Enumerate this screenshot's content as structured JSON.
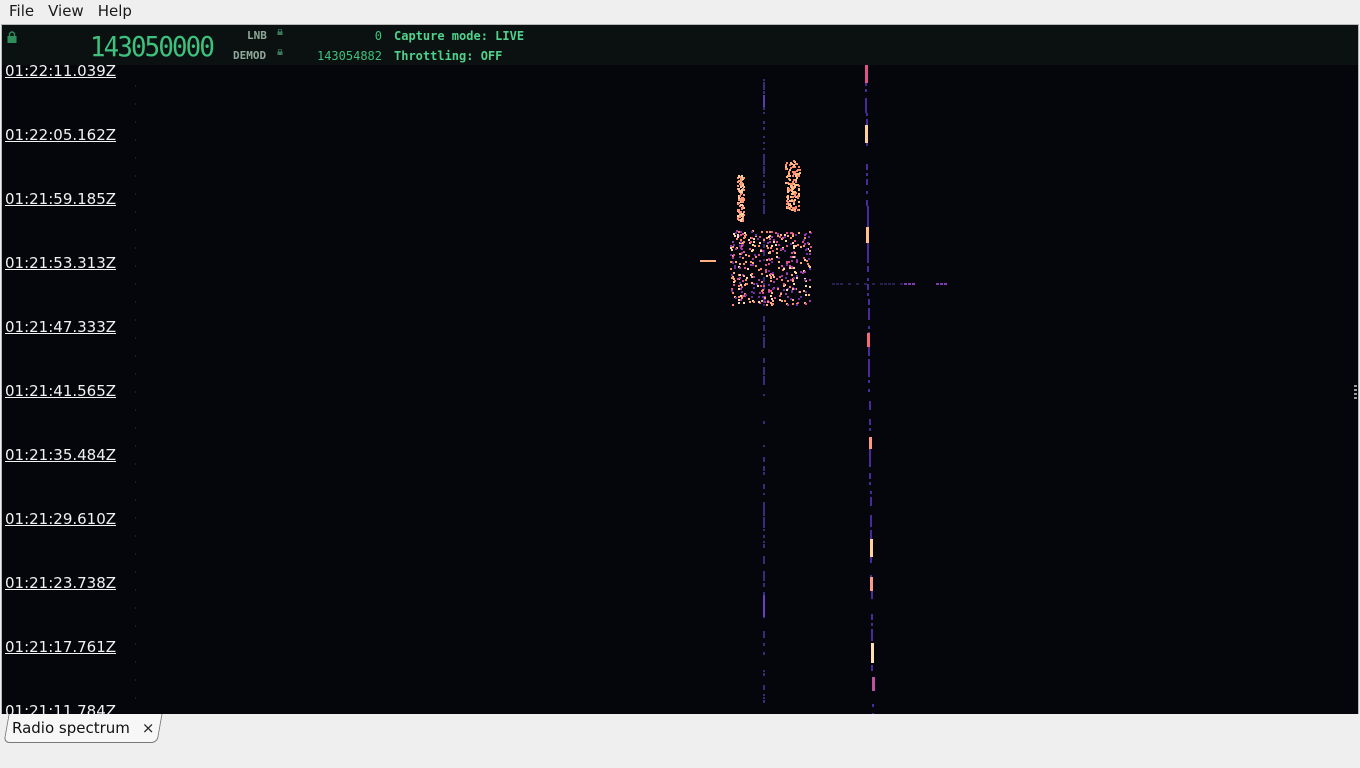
{
  "menu": {
    "file": "File",
    "view": "View",
    "help": "Help"
  },
  "header": {
    "main_freq": "143050000",
    "lnb_label": "LNB",
    "lnb_value": "0",
    "demod_label": "DEMOD",
    "demod_value": "143054882",
    "capture_mode": "Capture mode: LIVE",
    "throttling": "Throttling: OFF",
    "accent_color": "#3cc27e"
  },
  "timestamps": [
    "01:22:11.039Z",
    "01:22:05.162Z",
    "01:21:59.185Z",
    "01:21:53.313Z",
    "01:21:47.333Z",
    "01:21:41.565Z",
    "01:21:35.484Z",
    "01:21:29.610Z",
    "01:21:23.738Z",
    "01:21:17.761Z",
    "01:21:11.784Z"
  ],
  "tab": {
    "label": "Radio spectrum",
    "close": "×"
  }
}
